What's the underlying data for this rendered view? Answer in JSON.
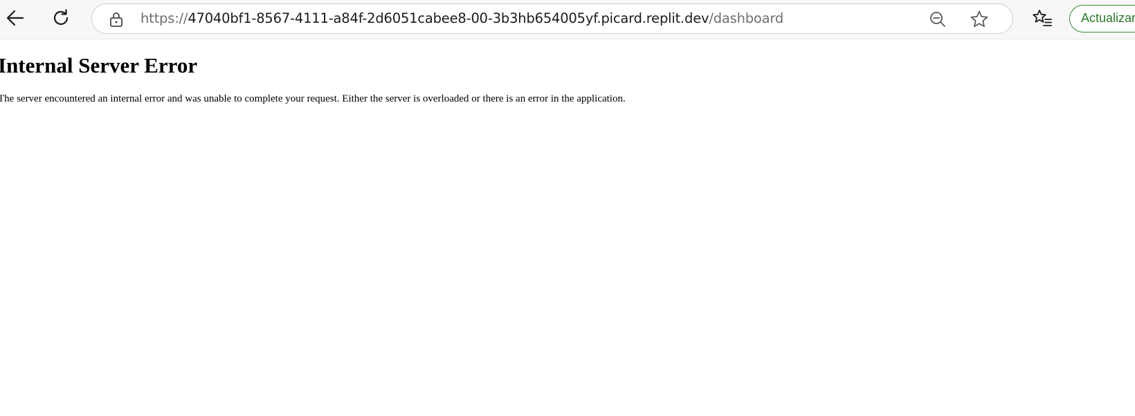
{
  "browser": {
    "url_scheme": "https://",
    "url_host": "47040bf1-8567-4111-a84f-2d6051cabee8-00-3b3hb654005yf.picard.replit.dev",
    "url_path": "/dashboard",
    "update_label": "Actualizar",
    "accent_color": "#3a8a3a",
    "icons": [
      "back-arrow-icon",
      "reload-icon",
      "lock-icon",
      "zoom-out-icon",
      "star-icon",
      "favorites-icon"
    ]
  },
  "page": {
    "heading": "Internal Server Error",
    "message": "The server encountered an internal error and was unable to complete your request. Either the server is overloaded or there is an error in the application."
  }
}
